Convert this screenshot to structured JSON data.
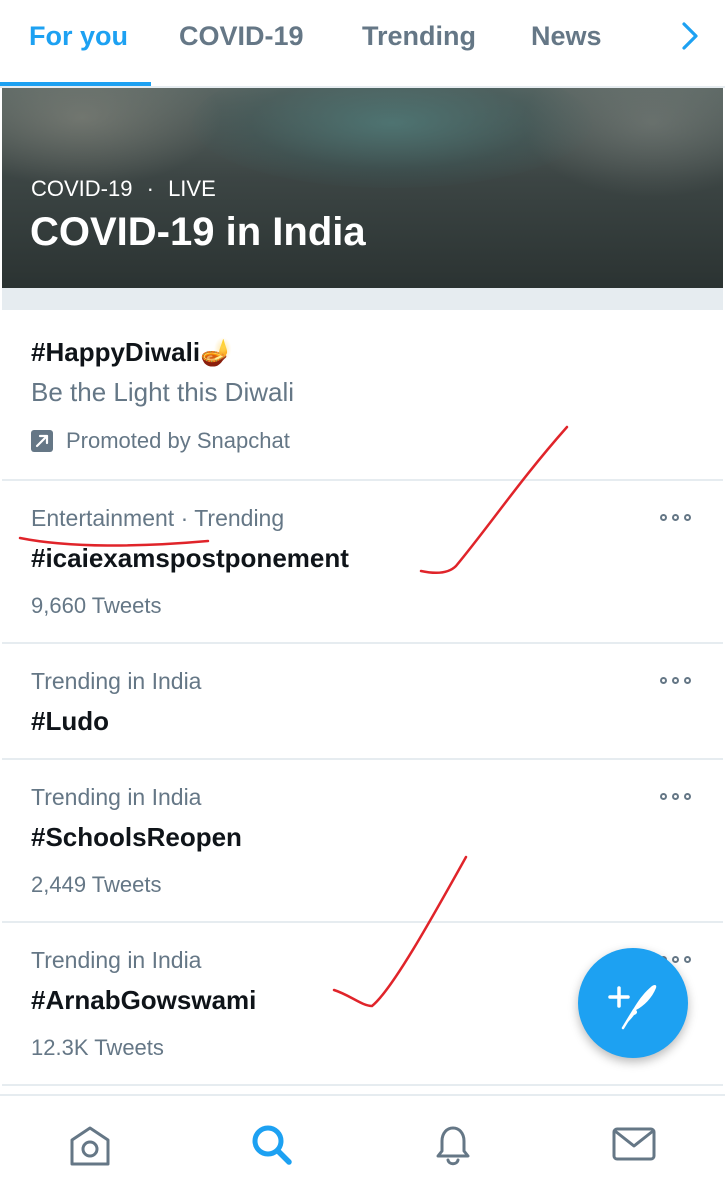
{
  "tabs": [
    {
      "label": "For you",
      "active": true
    },
    {
      "label": "COVID-19",
      "active": false
    },
    {
      "label": "Trending",
      "active": false
    },
    {
      "label": "News",
      "active": false
    }
  ],
  "hero": {
    "category": "COVID-19",
    "separator": "·",
    "status": "LIVE",
    "title": "COVID-19 in India"
  },
  "promoted": {
    "hashtag": "#HappyDiwali",
    "emoji": "🪔",
    "description": "Be the Light this Diwali",
    "promoted_by": "Promoted by Snapchat"
  },
  "trends": [
    {
      "context": "Entertainment · Trending",
      "hashtag": "#icaiexamspostponement",
      "count": "9,660 Tweets"
    },
    {
      "context": "Trending in India",
      "hashtag": "#Ludo",
      "count": ""
    },
    {
      "context": "Trending in India",
      "hashtag": "#SchoolsReopen",
      "count": "2,449 Tweets"
    },
    {
      "context": "Trending in India",
      "hashtag": "#ArnabGowswami",
      "count": "12.3K Tweets"
    }
  ],
  "colors": {
    "accent": "#1da1f2",
    "secondary_text": "#657786",
    "primary_text": "#0f1419",
    "divider": "#e6ecf0",
    "annotation_ink": "#e0242a"
  },
  "icons": {
    "tab_scroll": "chevron-right-icon",
    "promoted": "promoted-arrow-icon",
    "more": "more-dots-icon",
    "fab": "compose-tweet-icon",
    "nav": [
      "home-icon",
      "search-icon",
      "notifications-bell-icon",
      "messages-envelope-icon"
    ]
  }
}
